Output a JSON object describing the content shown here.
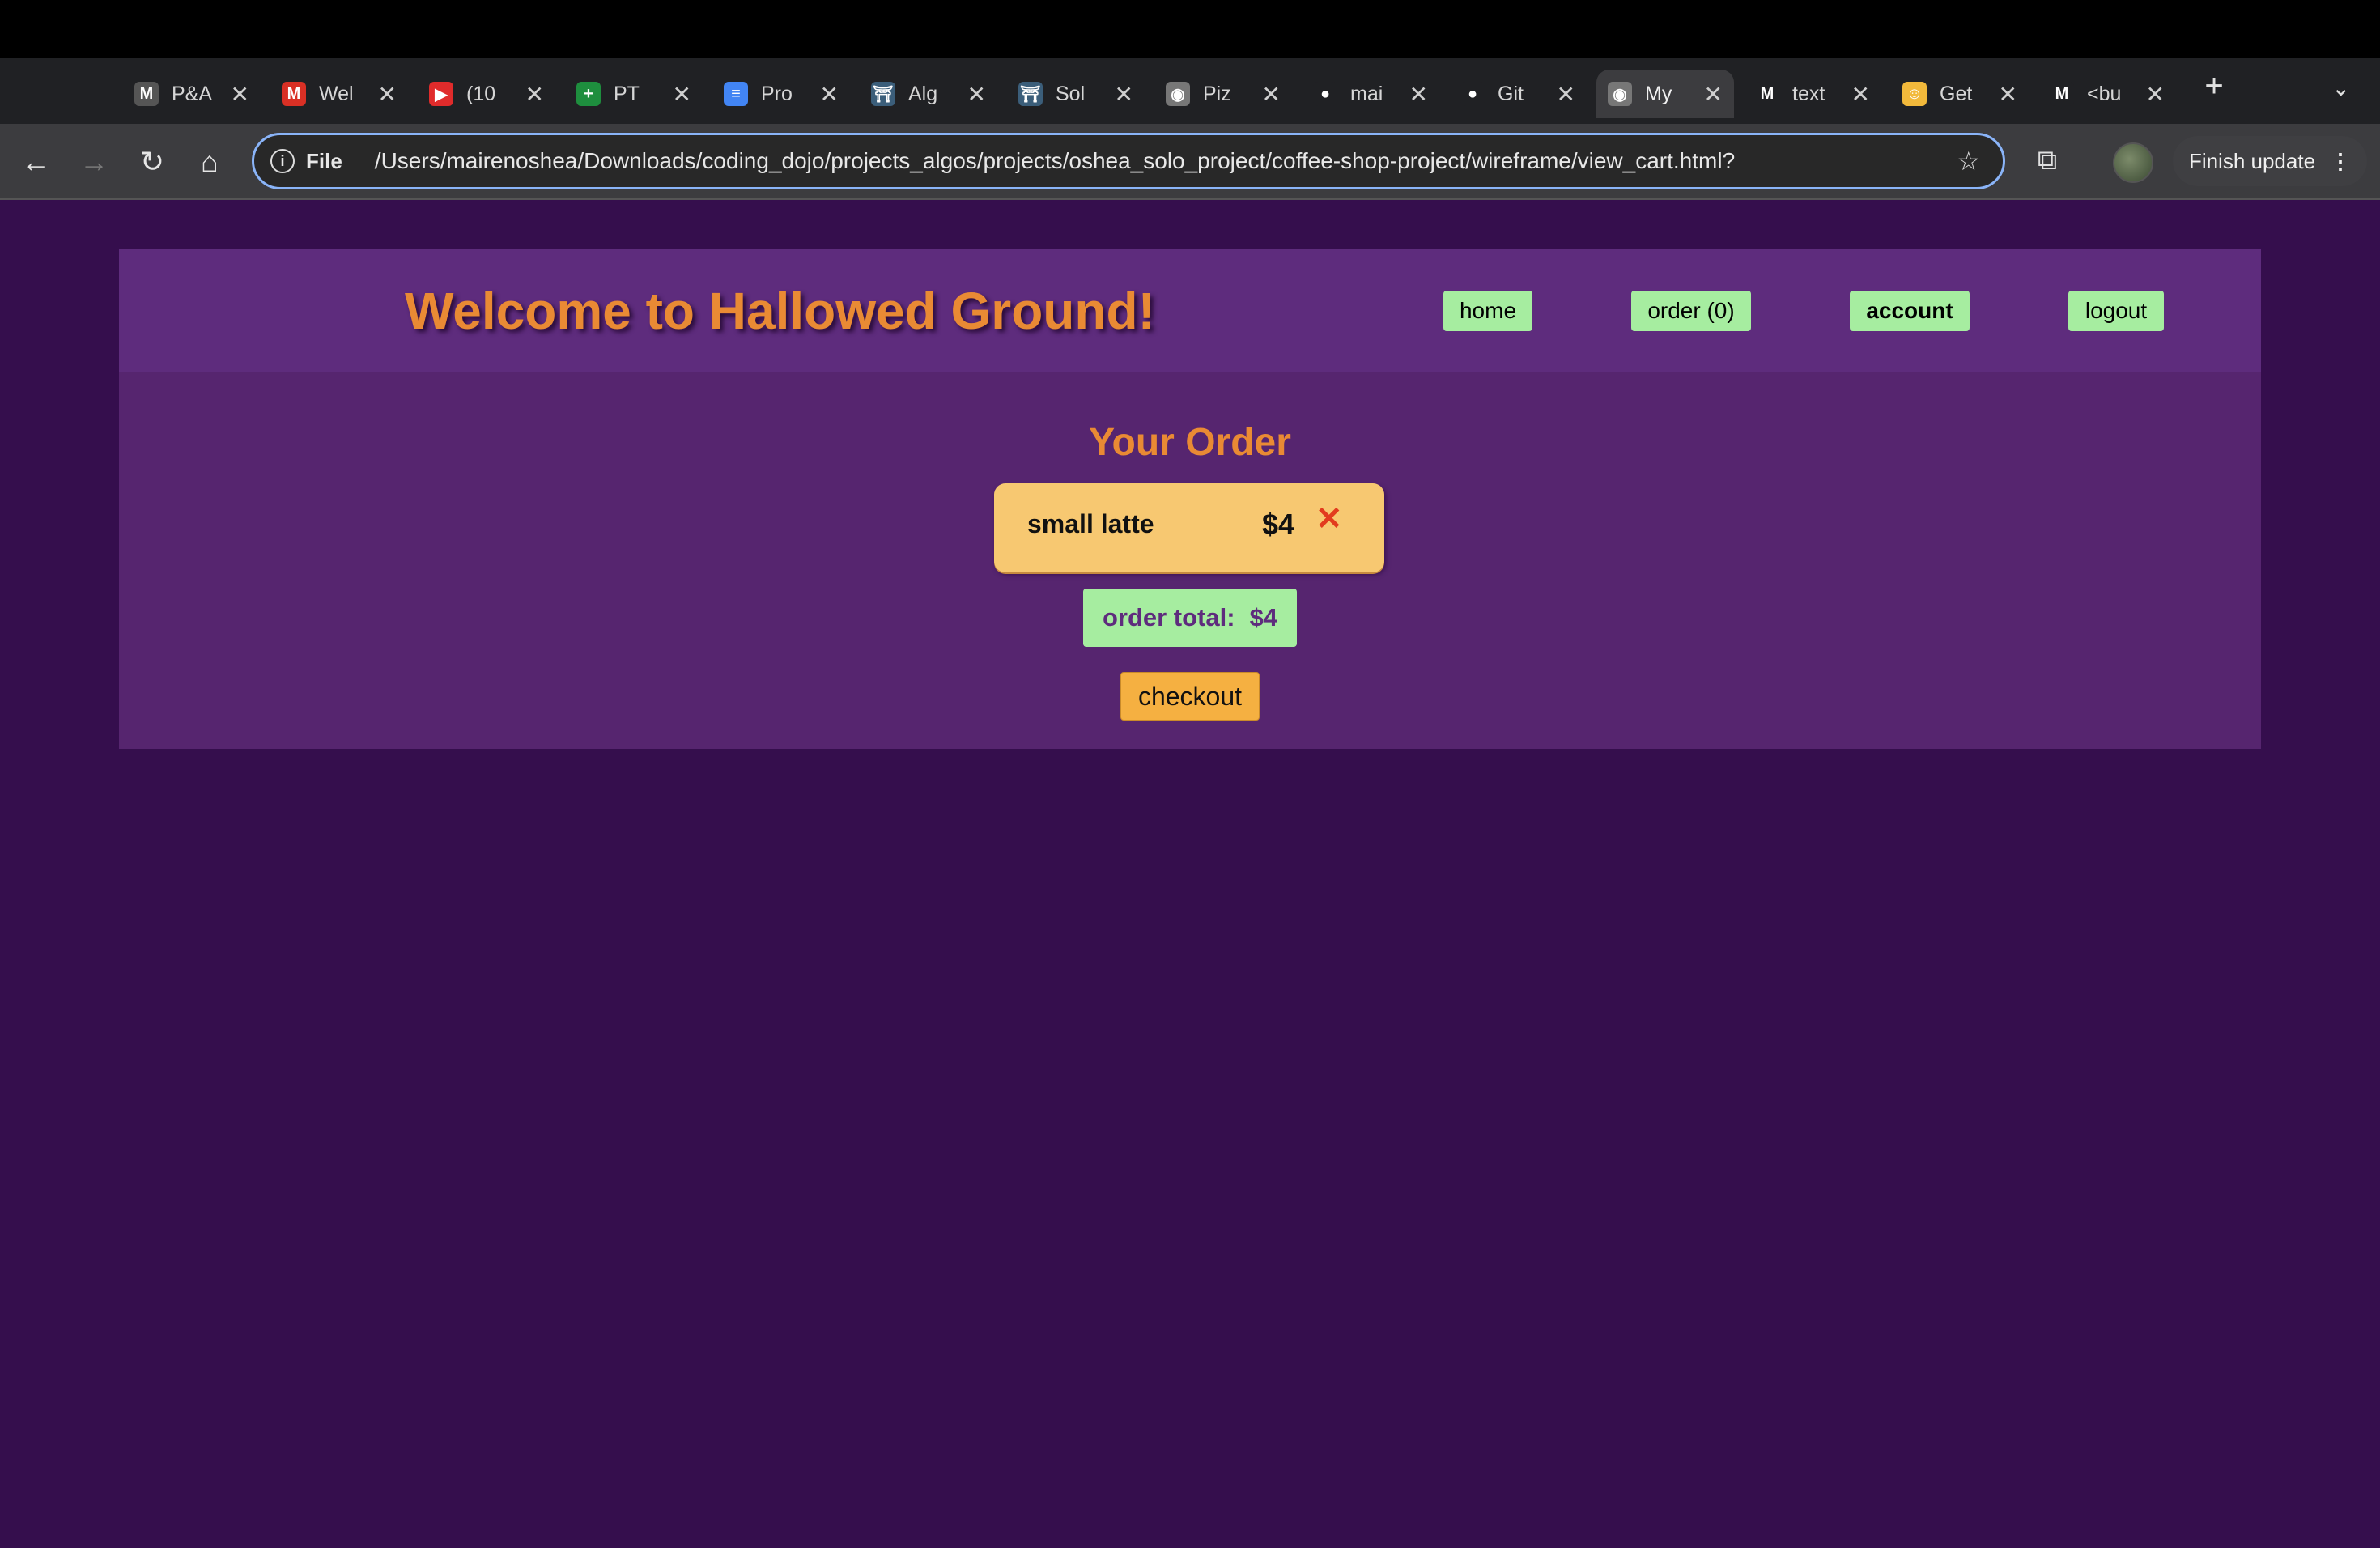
{
  "browser": {
    "tabs": [
      {
        "title": "P&A",
        "icon": "gmail-icon",
        "color": "#555"
      },
      {
        "title": "Wel",
        "icon": "gmail-icon",
        "color": "#d93025"
      },
      {
        "title": "(10",
        "icon": "youtube-icon",
        "color": "#e02b2b"
      },
      {
        "title": "PT",
        "icon": "sheets-icon",
        "color": "#1e8e3e"
      },
      {
        "title": "Pro",
        "icon": "docs-icon",
        "color": "#4285f4"
      },
      {
        "title": "Alg",
        "icon": "dojo-icon",
        "color": "#3b5e7a"
      },
      {
        "title": "Sol",
        "icon": "dojo-icon",
        "color": "#3b5e7a"
      },
      {
        "title": "Piz",
        "icon": "globe-icon",
        "color": "#777"
      },
      {
        "title": "mai",
        "icon": "github-icon",
        "color": "#202124"
      },
      {
        "title": "Git",
        "icon": "github-icon",
        "color": "#202124"
      },
      {
        "title": "My",
        "icon": "globe-icon",
        "color": "#777",
        "active": true
      },
      {
        "title": "text",
        "icon": "mdn-icon",
        "color": "#202124"
      },
      {
        "title": "Get",
        "icon": "emoji-icon",
        "color": "#f2b93b"
      },
      {
        "title": "<bu",
        "icon": "mdn-icon",
        "color": "#202124"
      }
    ],
    "address_scheme": "File",
    "url": "/Users/mairenoshea/Downloads/coding_dojo/projects_algos/projects/oshea_solo_project/coffee-shop-project/wireframe/view_cart.html?",
    "update_label": "Finish update"
  },
  "header": {
    "title": "Welcome to Hallowed Ground!",
    "nav": {
      "home": "home",
      "order": "order (0)",
      "account": "account",
      "logout": "logout"
    }
  },
  "cart": {
    "heading": "Your Order",
    "items": [
      {
        "name": "small latte",
        "price": "$4"
      }
    ],
    "total_label": "order total:",
    "total_value": "$4",
    "checkout_label": "checkout"
  }
}
